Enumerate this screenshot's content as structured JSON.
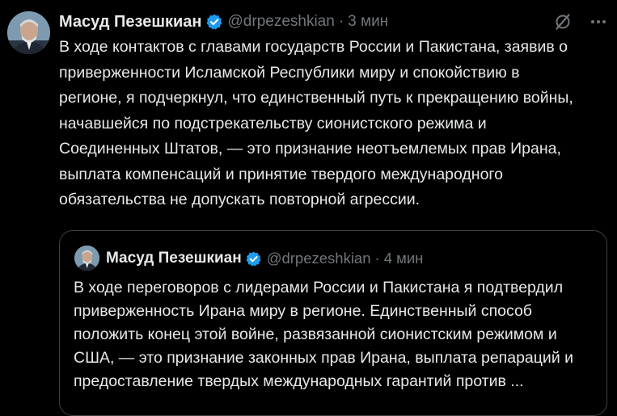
{
  "tweet": {
    "author": {
      "name": "Масуд Пезешкиан",
      "handle": "@drpezeshkian",
      "separator": "·",
      "time": "3 мин"
    },
    "text_lines": [
      "В ходе контактов с главами государств России и Пакистана, заявив о",
      "приверженности Исламской Республики миру и спокойствию в",
      "регионе, я подчеркнул, что единственный путь к прекращению войны,",
      "начавшейся по подстрекательству сионистского режима и",
      "Соединенных Штатов, — это признание неотъемлемых прав Ирана,",
      "выплата компенсаций и принятие твердого международного",
      "обязательства не допускать повторной агрессии."
    ],
    "actions": {
      "grok_icon": "grok-icon",
      "more_icon": "more-icon"
    }
  },
  "quote": {
    "author": {
      "name": "Масуд Пезешкиан",
      "handle": "@drpezeshkian",
      "separator": "·",
      "time": "4 мин"
    },
    "text_lines": [
      "В ходе переговоров с лидерами России и Пакистана я подтвердил",
      "приверженность Ирана миру в регионе. Единственный способ",
      "положить конец этой войне, развязанной сионистским режимом и",
      "США, — это признание законных прав Ирана, выплата репараций и",
      "предоставление твердых международных гарантий против ..."
    ]
  },
  "colors": {
    "background": "#000000",
    "text": "#e7e9ea",
    "secondary": "#71767b",
    "verified": "#1d9bf0",
    "border": "#3d4145"
  }
}
